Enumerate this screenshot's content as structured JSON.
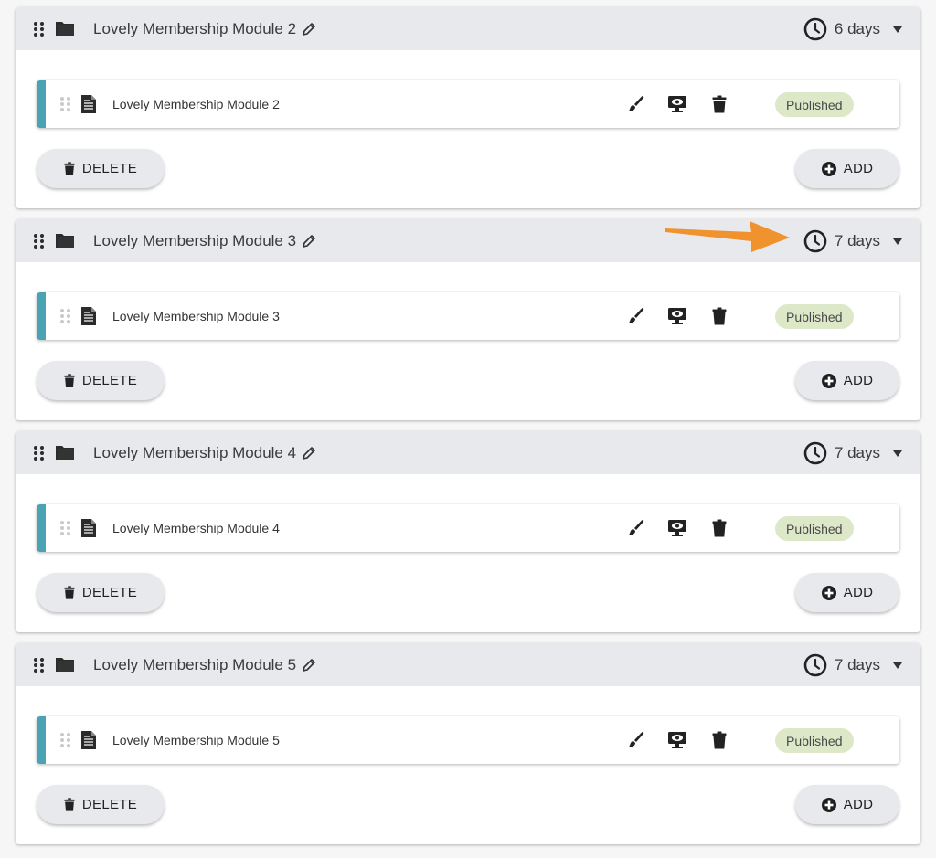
{
  "modules": [
    {
      "title": "Lovely Membership Module 2",
      "duration": "6 days",
      "lesson": {
        "title": "Lovely Membership Module 2",
        "status": "Published"
      },
      "delete_label": "DELETE",
      "add_label": "ADD"
    },
    {
      "title": "Lovely Membership Module 3",
      "duration": "7 days",
      "lesson": {
        "title": "Lovely Membership Module 3",
        "status": "Published"
      },
      "delete_label": "DELETE",
      "add_label": "ADD"
    },
    {
      "title": "Lovely Membership Module 4",
      "duration": "7 days",
      "lesson": {
        "title": "Lovely Membership Module 4",
        "status": "Published"
      },
      "delete_label": "DELETE",
      "add_label": "ADD"
    },
    {
      "title": "Lovely Membership Module 5",
      "duration": "7 days",
      "lesson": {
        "title": "Lovely Membership Module 5",
        "status": "Published"
      },
      "delete_label": "DELETE",
      "add_label": "ADD"
    }
  ],
  "icons": {
    "drag": "drag-handle-icon",
    "folder": "folder-icon",
    "edit": "pencil-icon",
    "duration": "clock-icon",
    "expand": "caret-down-icon",
    "lesson": "document-icon",
    "design": "paintbrush-icon",
    "preview": "preview-eye-icon",
    "remove": "trash-icon",
    "add": "plus-circle-icon"
  },
  "annotation": {
    "type": "arrow",
    "points_to": "module 3 duration",
    "color": "#f0922d"
  },
  "colors": {
    "header_bg": "#e8e9ec",
    "lesson_accent": "#4aa3b2",
    "published_badge": "#dde8c9",
    "button_bg": "#e8e9ec"
  }
}
